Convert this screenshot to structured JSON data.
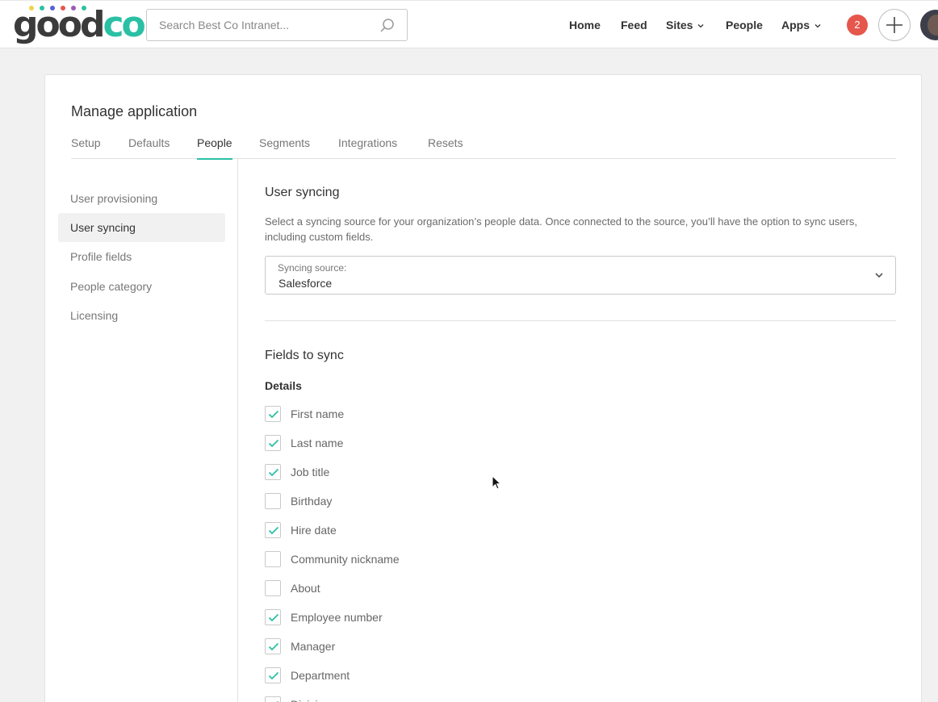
{
  "brand": {
    "logo_left": "good",
    "logo_right": "co",
    "dot_colors": [
      "#f2d24c",
      "#2bc0a5",
      "#5a5fd6",
      "#e5564c",
      "#9c5ab8"
    ]
  },
  "search": {
    "placeholder": "Search Best Co Intranet..."
  },
  "nav": {
    "home": "Home",
    "feed": "Feed",
    "sites": "Sites",
    "people": "People",
    "apps": "Apps"
  },
  "notifications": {
    "count": "2"
  },
  "page": {
    "title": "Manage application",
    "tabs": [
      "Setup",
      "Defaults",
      "People",
      "Segments",
      "Integrations",
      "Resets"
    ],
    "active_tab": "People"
  },
  "sidebar": {
    "items": [
      "User provisioning",
      "User syncing",
      "Profile fields",
      "People category",
      "Licensing"
    ],
    "active_item": "User syncing"
  },
  "user_syncing": {
    "heading": "User syncing",
    "description": "Select a syncing source for your organization’s people data. Once connected to the source, you’ll have the option to sync users, including custom fields.",
    "source_label": "Syncing source:",
    "source_value": "Salesforce"
  },
  "fields_to_sync": {
    "heading": "Fields to sync",
    "group_label": "Details",
    "fields": [
      {
        "label": "First name",
        "checked": true
      },
      {
        "label": "Last name",
        "checked": true
      },
      {
        "label": "Job title",
        "checked": true
      },
      {
        "label": "Birthday",
        "checked": false
      },
      {
        "label": "Hire date",
        "checked": true
      },
      {
        "label": "Community nickname",
        "checked": false
      },
      {
        "label": "About",
        "checked": false
      },
      {
        "label": "Employee number",
        "checked": true
      },
      {
        "label": "Manager",
        "checked": true
      },
      {
        "label": "Department",
        "checked": true
      },
      {
        "label": "Division",
        "checked": true
      }
    ]
  },
  "colors": {
    "accent": "#2bc0a5",
    "badge": "#e5564c"
  }
}
